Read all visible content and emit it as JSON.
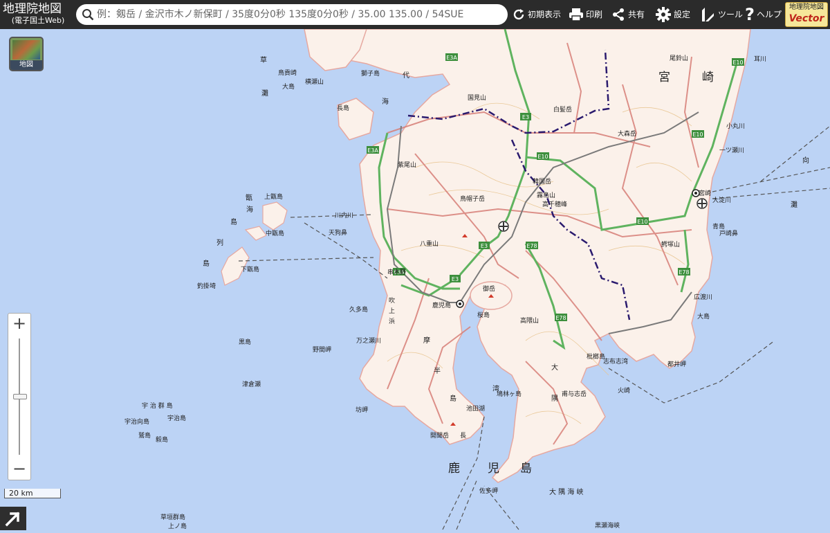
{
  "app": {
    "title_line1": "地理院地図",
    "title_line2": "(電子国土Web)"
  },
  "search": {
    "placeholder": "例：剱岳 / 金沢市木ノ新保町 / 35度0分0秒 135度0分0秒 / 35.00 135.00 / 54SUE"
  },
  "toolbar": {
    "home_label": "初期表示",
    "print_label": "印刷",
    "share_label": "共有",
    "settings_label": "設定",
    "tools_label": "ツール",
    "help_label": "ヘルプ",
    "vector_badge_line1": "地理院地図",
    "vector_badge_line2": "Vector"
  },
  "layer_button": {
    "label": "地図"
  },
  "zoom": {
    "in_label": "+",
    "out_label": "−"
  },
  "scale": {
    "label": "20 km"
  },
  "map": {
    "prefectures": [
      {
        "id": "miyazaki",
        "chars": [
          "宮",
          "崎"
        ]
      },
      {
        "id": "kagoshima",
        "chars": [
          "鹿",
          "児",
          "島"
        ]
      }
    ],
    "place_labels": [
      "鳥帽子岳",
      "国見山",
      "白髪岳",
      "大森岳",
      "韓国岳",
      "霧島山",
      "高千穂峰",
      "紫尾山",
      "八重山",
      "鹿児島",
      "桜島",
      "御岳",
      "高隈山",
      "甫与志岳",
      "開聞岳",
      "池田湖",
      "宮崎",
      "大淀川",
      "鰐塚山",
      "上甑島",
      "中甑島",
      "下甑島",
      "天狗鼻",
      "川内川",
      "久多島",
      "万之瀬川",
      "野間岬",
      "坊岬",
      "津倉瀬",
      "宇治群島",
      "宇治向島",
      "宇治島",
      "鷲島",
      "黒島",
      "枕崎",
      "佐多岬",
      "大隅半島",
      "薩摩半島",
      "日南海岸",
      "志布志湾",
      "都井岬",
      "火崎",
      "広渡川",
      "大島",
      "黒瀬",
      "尾鈴山",
      "耳川",
      "小丸川",
      "一ツ瀬川",
      "青島",
      "戸崎鼻",
      "枇榔島",
      "蒲葵島",
      "鹿児島湾",
      "天降川",
      "燃島",
      "草垣群島",
      "上ノ島",
      "大島",
      "長島",
      "獅子島",
      "串木野",
      "吹上浜",
      "吹上",
      "海",
      "代",
      "瀬",
      "灘",
      "鳥",
      "列",
      "向",
      "薩",
      "摩",
      "半",
      "島",
      "大",
      "隅",
      "峡",
      "海"
    ],
    "road_labels": [
      "E3A",
      "E3",
      "E10",
      "E78",
      "E3A",
      "E3",
      "E3",
      "E10",
      "E10",
      "E78",
      "E78"
    ]
  },
  "colors": {
    "sea": "#bcd3f5",
    "land": "#fbf1ea",
    "land_edge": "#e6a8a0",
    "road": "#d77f78",
    "expressway": "#5fb35f",
    "border": "#2a1a6e",
    "header": "#2b2b2b"
  }
}
